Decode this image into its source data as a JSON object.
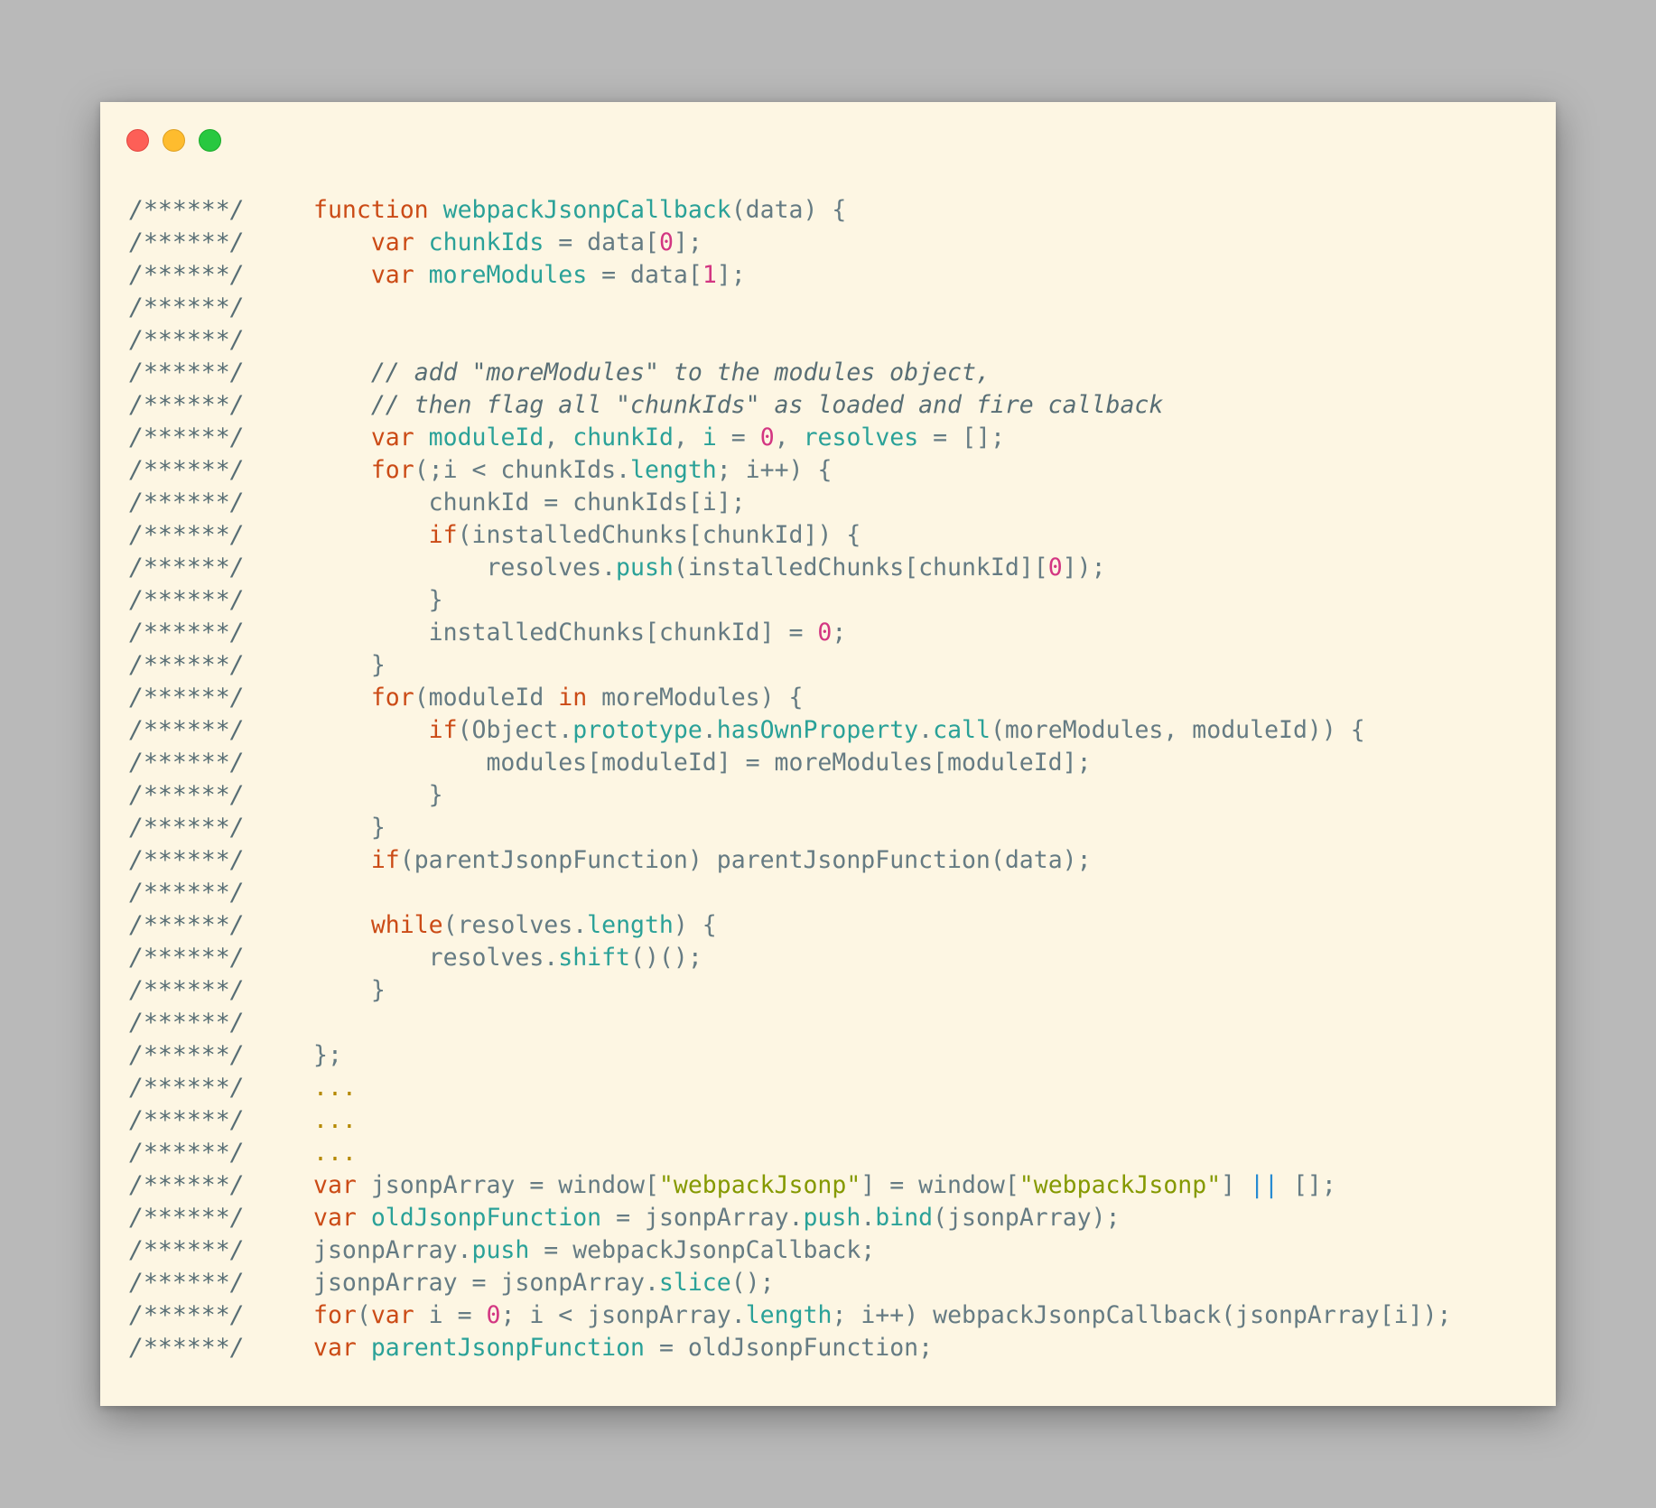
{
  "window": {
    "controls": [
      "close",
      "minimize",
      "zoom"
    ]
  },
  "gutter_marker": "/******/",
  "lines": [
    {
      "tokens": [
        [
          "kw",
          "function"
        ],
        [
          "p",
          " "
        ],
        [
          "fn",
          "webpackJsonpCallback"
        ],
        [
          "p",
          "(data) {"
        ]
      ]
    },
    {
      "tokens": [
        [
          "p",
          "    "
        ],
        [
          "kw",
          "var"
        ],
        [
          "p",
          " "
        ],
        [
          "fn",
          "chunkIds"
        ],
        [
          "p",
          " = data["
        ],
        [
          "num",
          "0"
        ],
        [
          "p",
          "];"
        ]
      ]
    },
    {
      "tokens": [
        [
          "p",
          "    "
        ],
        [
          "kw",
          "var"
        ],
        [
          "p",
          " "
        ],
        [
          "fn",
          "moreModules"
        ],
        [
          "p",
          " = data["
        ],
        [
          "num",
          "1"
        ],
        [
          "p",
          "];"
        ]
      ]
    },
    {
      "tokens": []
    },
    {
      "tokens": []
    },
    {
      "tokens": [
        [
          "p",
          "    "
        ],
        [
          "cm",
          "// add \"moreModules\" to the modules object,"
        ]
      ]
    },
    {
      "tokens": [
        [
          "p",
          "    "
        ],
        [
          "cm",
          "// then flag all \"chunkIds\" as loaded and fire callback"
        ]
      ]
    },
    {
      "tokens": [
        [
          "p",
          "    "
        ],
        [
          "kw",
          "var"
        ],
        [
          "p",
          " "
        ],
        [
          "fn",
          "moduleId"
        ],
        [
          "p",
          ", "
        ],
        [
          "fn",
          "chunkId"
        ],
        [
          "p",
          ", "
        ],
        [
          "fn",
          "i"
        ],
        [
          "p",
          " = "
        ],
        [
          "num",
          "0"
        ],
        [
          "p",
          ", "
        ],
        [
          "fn",
          "resolves"
        ],
        [
          "p",
          " = [];"
        ]
      ]
    },
    {
      "tokens": [
        [
          "p",
          "    "
        ],
        [
          "kw",
          "for"
        ],
        [
          "p",
          "(;i < chunkIds."
        ],
        [
          "fn",
          "length"
        ],
        [
          "p",
          "; i++) {"
        ]
      ]
    },
    {
      "tokens": [
        [
          "p",
          "        chunkId = chunkIds[i];"
        ]
      ]
    },
    {
      "tokens": [
        [
          "p",
          "        "
        ],
        [
          "kw",
          "if"
        ],
        [
          "p",
          "(installedChunks[chunkId]) {"
        ]
      ]
    },
    {
      "tokens": [
        [
          "p",
          "            resolves."
        ],
        [
          "fn",
          "push"
        ],
        [
          "p",
          "(installedChunks[chunkId]["
        ],
        [
          "num",
          "0"
        ],
        [
          "p",
          "]);"
        ]
      ]
    },
    {
      "tokens": [
        [
          "p",
          "        }"
        ]
      ]
    },
    {
      "tokens": [
        [
          "p",
          "        installedChunks[chunkId] = "
        ],
        [
          "num",
          "0"
        ],
        [
          "p",
          ";"
        ]
      ]
    },
    {
      "tokens": [
        [
          "p",
          "    }"
        ]
      ]
    },
    {
      "tokens": [
        [
          "p",
          "    "
        ],
        [
          "kw",
          "for"
        ],
        [
          "p",
          "(moduleId "
        ],
        [
          "kw",
          "in"
        ],
        [
          "p",
          " moreModules) {"
        ]
      ]
    },
    {
      "tokens": [
        [
          "p",
          "        "
        ],
        [
          "kw",
          "if"
        ],
        [
          "p",
          "(Object."
        ],
        [
          "fn",
          "prototype"
        ],
        [
          "p",
          "."
        ],
        [
          "fn",
          "hasOwnProperty"
        ],
        [
          "p",
          "."
        ],
        [
          "fn",
          "call"
        ],
        [
          "p",
          "(moreModules, moduleId)) {"
        ]
      ]
    },
    {
      "tokens": [
        [
          "p",
          "            modules[moduleId] = moreModules[moduleId];"
        ]
      ]
    },
    {
      "tokens": [
        [
          "p",
          "        }"
        ]
      ]
    },
    {
      "tokens": [
        [
          "p",
          "    }"
        ]
      ]
    },
    {
      "tokens": [
        [
          "p",
          "    "
        ],
        [
          "kw",
          "if"
        ],
        [
          "p",
          "(parentJsonpFunction) parentJsonpFunction(data);"
        ]
      ]
    },
    {
      "tokens": []
    },
    {
      "tokens": [
        [
          "p",
          "    "
        ],
        [
          "kw",
          "while"
        ],
        [
          "p",
          "(resolves."
        ],
        [
          "fn",
          "length"
        ],
        [
          "p",
          ") {"
        ]
      ]
    },
    {
      "tokens": [
        [
          "p",
          "        resolves."
        ],
        [
          "fn",
          "shift"
        ],
        [
          "p",
          "()();"
        ]
      ]
    },
    {
      "tokens": [
        [
          "p",
          "    }"
        ]
      ]
    },
    {
      "tokens": []
    },
    {
      "tokens": [
        [
          "p",
          "};"
        ]
      ]
    },
    {
      "tokens": [
        [
          "dots",
          "..."
        ]
      ]
    },
    {
      "tokens": [
        [
          "dots",
          "..."
        ]
      ]
    },
    {
      "tokens": [
        [
          "dots",
          "..."
        ]
      ]
    },
    {
      "tokens": [
        [
          "kw",
          "var"
        ],
        [
          "p",
          " jsonpArray = window["
        ],
        [
          "str",
          "\"webpackJsonp\""
        ],
        [
          "p",
          "] = window["
        ],
        [
          "str",
          "\"webpackJsonp\""
        ],
        [
          "p",
          "] "
        ],
        [
          "op",
          "||"
        ],
        [
          "p",
          " [];"
        ]
      ]
    },
    {
      "tokens": [
        [
          "kw",
          "var"
        ],
        [
          "p",
          " "
        ],
        [
          "fn",
          "oldJsonpFunction"
        ],
        [
          "p",
          " = jsonpArray."
        ],
        [
          "fn",
          "push"
        ],
        [
          "p",
          "."
        ],
        [
          "fn",
          "bind"
        ],
        [
          "p",
          "(jsonpArray);"
        ]
      ]
    },
    {
      "tokens": [
        [
          "p",
          "jsonpArray."
        ],
        [
          "fn",
          "push"
        ],
        [
          "p",
          " = webpackJsonpCallback;"
        ]
      ]
    },
    {
      "tokens": [
        [
          "p",
          "jsonpArray = jsonpArray."
        ],
        [
          "fn",
          "slice"
        ],
        [
          "p",
          "();"
        ]
      ]
    },
    {
      "tokens": [
        [
          "kw",
          "for"
        ],
        [
          "p",
          "("
        ],
        [
          "kw",
          "var"
        ],
        [
          "p",
          " i = "
        ],
        [
          "num",
          "0"
        ],
        [
          "p",
          "; i < jsonpArray."
        ],
        [
          "fn",
          "length"
        ],
        [
          "p",
          "; i++) webpackJsonpCallback(jsonpArray[i]);"
        ]
      ]
    },
    {
      "tokens": [
        [
          "kw",
          "var"
        ],
        [
          "p",
          " "
        ],
        [
          "fn",
          "parentJsonpFunction"
        ],
        [
          "p",
          " = oldJsonpFunction;"
        ]
      ]
    }
  ]
}
